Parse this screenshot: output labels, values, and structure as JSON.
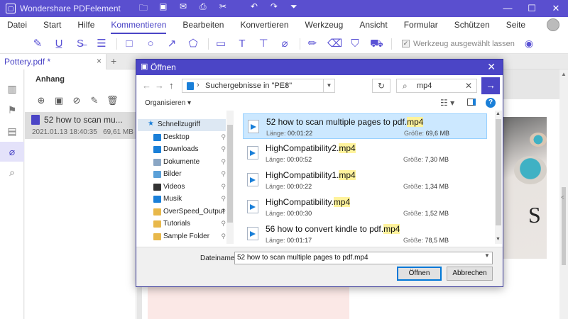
{
  "app": {
    "title": "Wondershare PDFelement",
    "icons": [
      "folder-icon",
      "save-icon",
      "mail-icon",
      "print-icon",
      "cut-icon",
      "undo-icon",
      "redo-icon",
      "dropdown-icon"
    ]
  },
  "menu": {
    "items": [
      "Datei",
      "Start",
      "Hilfe",
      "Kommentieren",
      "Bearbeiten",
      "Konvertieren",
      "Werkzeug",
      "Ansicht",
      "Formular",
      "Schützen",
      "Seite"
    ],
    "active": "Kommentieren"
  },
  "toolbar": {
    "keep_tool_label": "Werkzeug ausgewählt lassen",
    "accent": "#5a52d5"
  },
  "tabs": {
    "doc": "Pottery.pdf *",
    "close": "×",
    "add": "+"
  },
  "attachments": {
    "heading": "Anhang",
    "item_name": "52 how to scan mu...",
    "item_date": "2021.01.13 18:40:35",
    "item_size": "69,61 MB"
  },
  "dialog": {
    "title": "Öffnen",
    "path": "Suchergebnisse in \"PE8\"",
    "search_value": "mp4",
    "organize": "Organisieren",
    "nav": [
      {
        "label": "Schnellzugriff",
        "icon": "star-icon",
        "color": "#1a7fd8",
        "pinned": false
      },
      {
        "label": "Desktop",
        "icon": "desktop-icon",
        "color": "#1a7fd8",
        "pinned": true
      },
      {
        "label": "Downloads",
        "icon": "downloads-icon",
        "color": "#1a7fd8",
        "pinned": true
      },
      {
        "label": "Dokumente",
        "icon": "documents-icon",
        "color": "#8aa6c4",
        "pinned": true
      },
      {
        "label": "Bilder",
        "icon": "pictures-icon",
        "color": "#5aa0d8",
        "pinned": true
      },
      {
        "label": "Videos",
        "icon": "videos-icon",
        "color": "#333333",
        "pinned": true
      },
      {
        "label": "Musik",
        "icon": "music-icon",
        "color": "#1a7fd8",
        "pinned": true
      },
      {
        "label": "OverSpeed_Output",
        "icon": "folder-icon",
        "color": "#e8b84a",
        "pinned": true
      },
      {
        "label": "Tutorials",
        "icon": "folder-icon",
        "color": "#e8b84a",
        "pinned": true
      },
      {
        "label": "Sample Folder",
        "icon": "folder-icon",
        "color": "#e8b84a",
        "pinned": true
      }
    ],
    "len_label": "Länge:",
    "size_label": "Größe:",
    "files": [
      {
        "name_pre": "52 how to scan multiple pages to pdf.",
        "name_hl": "mp4",
        "name_post": "",
        "length": "00:01:22",
        "size": "69,6 MB",
        "selected": true
      },
      {
        "name_pre": "HighCompatibility2.",
        "name_hl": "mp4",
        "name_post": "",
        "length": "00:00:52",
        "size": "7,30 MB",
        "selected": false
      },
      {
        "name_pre": "HighCompatibility1.",
        "name_hl": "mp4",
        "name_post": "",
        "length": "00:00:22",
        "size": "1,34 MB",
        "selected": false
      },
      {
        "name_pre": "HighCompatibility.",
        "name_hl": "mp4",
        "name_post": "",
        "length": "00:00:30",
        "size": "1,52 MB",
        "selected": false
      },
      {
        "name_pre": "56 how to convert kindle to pdf.",
        "name_hl": "mp4",
        "name_post": "",
        "length": "00:01:17",
        "size": "78,5 MB",
        "selected": false
      }
    ],
    "filename_label": "Dateiname:",
    "filename_value": "52 how to scan multiple pages to pdf.mp4",
    "open_button": "Öffnen",
    "cancel_button": "Abbrechen"
  }
}
